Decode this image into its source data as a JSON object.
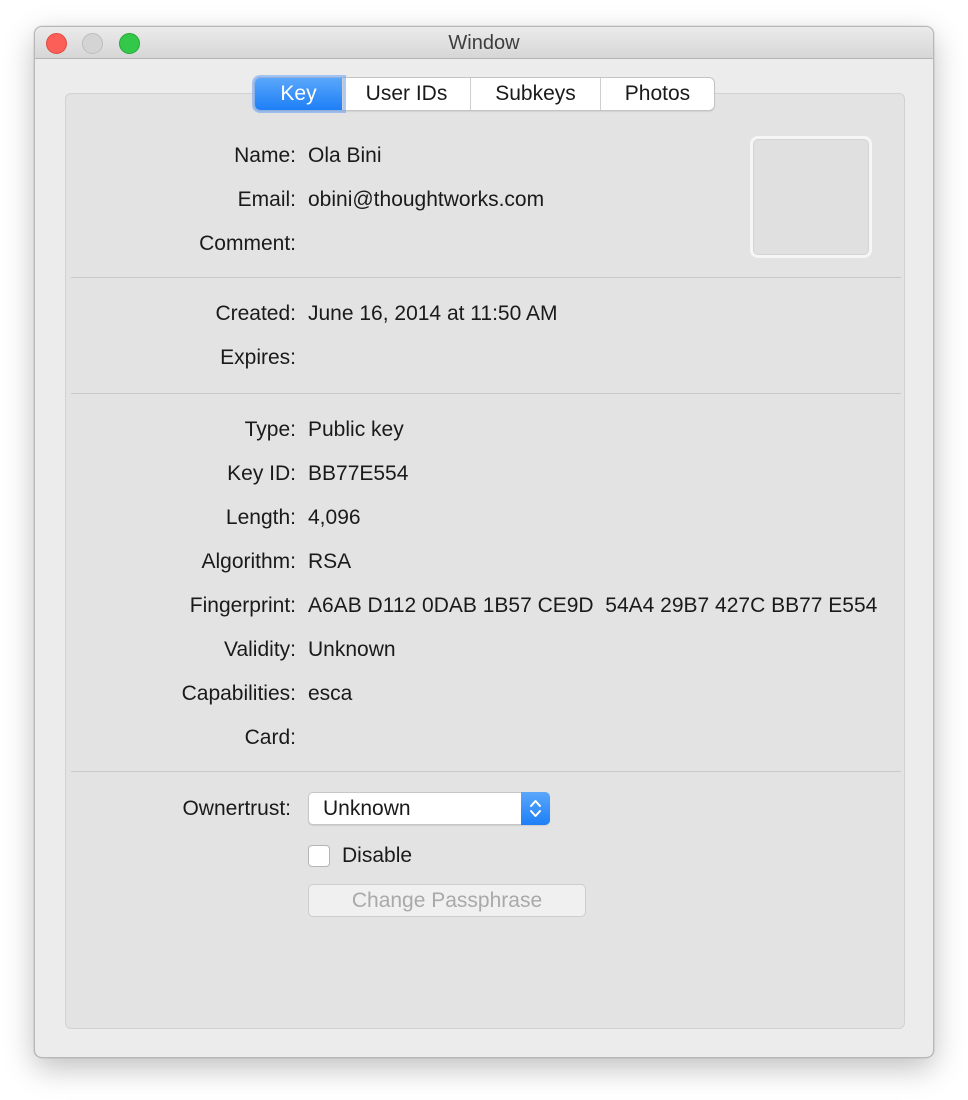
{
  "window": {
    "title": "Window"
  },
  "tabs": [
    {
      "label": "Key",
      "active": true
    },
    {
      "label": "User IDs",
      "active": false
    },
    {
      "label": "Subkeys",
      "active": false
    },
    {
      "label": "Photos",
      "active": false
    }
  ],
  "identity": {
    "name_label": "Name:",
    "name": "Ola Bini",
    "email_label": "Email:",
    "email": "obini@thoughtworks.com",
    "comment_label": "Comment:",
    "comment": ""
  },
  "dates": {
    "created_label": "Created:",
    "created": "June 16, 2014 at 11:50 AM",
    "expires_label": "Expires:",
    "expires": ""
  },
  "details": {
    "type_label": "Type:",
    "type": "Public key",
    "keyid_label": "Key ID:",
    "keyid": "BB77E554",
    "length_label": "Length:",
    "length": "4,096",
    "algorithm_label": "Algorithm:",
    "algorithm": "RSA",
    "fingerprint_label": "Fingerprint:",
    "fingerprint": "A6AB D112 0DAB 1B57 CE9D  54A4 29B7 427C BB77 E554",
    "validity_label": "Validity:",
    "validity": "Unknown",
    "capabilities_label": "Capabilities:",
    "capabilities": "esca",
    "card_label": "Card:",
    "card": ""
  },
  "trust": {
    "ownertrust_label": "Ownertrust:",
    "ownertrust_value": "Unknown",
    "disable_label": "Disable",
    "disable_checked": false,
    "change_passphrase_label": "Change Passphrase"
  },
  "colors": {
    "accent": "#1d7ff6",
    "close": "#fc5f57",
    "zoom": "#34c84a"
  }
}
